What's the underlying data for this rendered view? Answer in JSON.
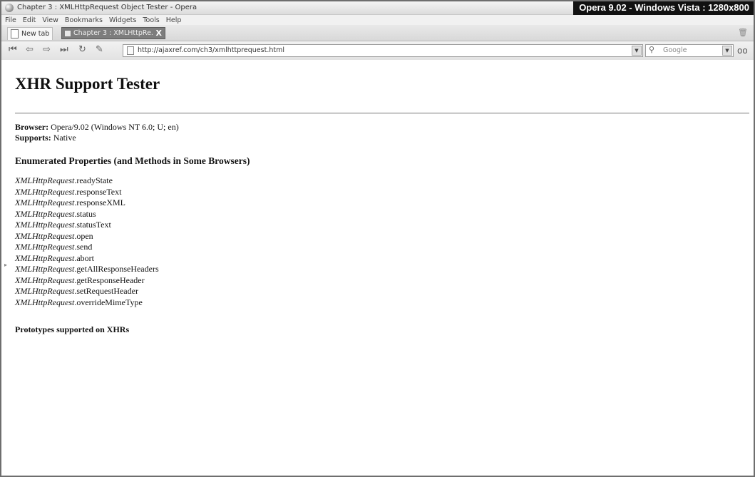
{
  "window": {
    "title": "Chapter 3 : XMLHttpRequest Object Tester - Opera",
    "badge": "Opera 9.02 - Windows Vista : 1280x800"
  },
  "menu": [
    "File",
    "Edit",
    "View",
    "Bookmarks",
    "Widgets",
    "Tools",
    "Help"
  ],
  "tabs": {
    "new_tab_label": "New tab",
    "active_tab_label": "Chapter 3 : XMLHttpRe...",
    "close_glyph": "X"
  },
  "toolbar": {
    "address": "http://ajaxref.com/ch3/xmlhttprequest.html",
    "search_placeholder": "Google"
  },
  "page": {
    "heading": "XHR Support Tester",
    "browser_label": "Browser:",
    "browser_value": "Opera/9.02 (Windows NT 6.0; U; en)",
    "supports_label": "Supports:",
    "supports_value": "Native",
    "section_title": "Enumerated Properties (and Methods in Some Browsers)",
    "object_name": "XMLHttpRequest",
    "properties": [
      ".readyState",
      ".responseText",
      ".responseXML",
      ".status",
      ".statusText",
      ".open",
      ".send",
      ".abort",
      ".getAllResponseHeaders",
      ".getResponseHeader",
      ".setRequestHeader",
      ".overrideMimeType"
    ],
    "prototypes_title": "Prototypes supported on XHRs"
  }
}
